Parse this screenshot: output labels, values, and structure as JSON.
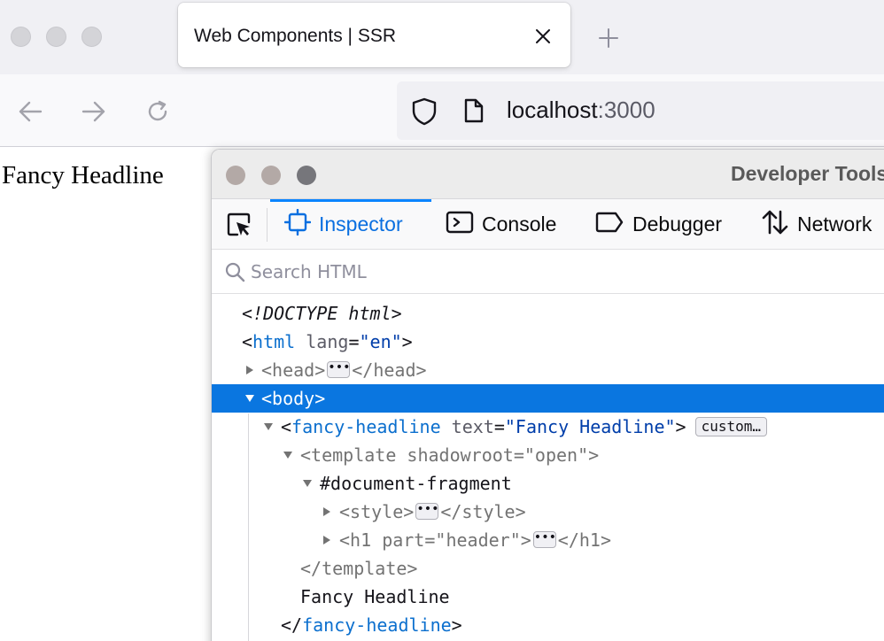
{
  "browser": {
    "tab": {
      "title": "Web Components | SSR"
    },
    "url": {
      "host": "localhost",
      "port": ":3000"
    }
  },
  "page": {
    "headline": "Fancy Headline"
  },
  "devtools": {
    "title": "Developer Tools",
    "tabs": [
      {
        "label": "Inspector",
        "icon": "inspector-icon",
        "selected": true
      },
      {
        "label": "Console",
        "icon": "console-icon"
      },
      {
        "label": "Debugger",
        "icon": "debugger-icon"
      },
      {
        "label": "Network",
        "icon": "network-icon"
      }
    ],
    "search_placeholder": "Search HTML",
    "tree": {
      "doctype": "<!DOCTYPE html>",
      "html": {
        "tag": "html",
        "attr": "lang",
        "value": "\"en\""
      },
      "head": {
        "tag": "head",
        "close": "</head>"
      },
      "body": {
        "tag": "body"
      },
      "fancy": {
        "tag": "fancy-headline",
        "attr": "text",
        "value": "\"Fancy Headline\"",
        "badge": "custom…"
      },
      "template": {
        "tag": "template",
        "attr": "shadowroot",
        "value": "\"open\"",
        "close": "</template>"
      },
      "fragment": "#document-fragment",
      "style": {
        "tag": "style",
        "close": "</style>"
      },
      "h1": {
        "tag": "h1",
        "attr": "part",
        "value": "\"header\"",
        "close": "</h1>"
      },
      "text_node": "Fancy Headline",
      "fancy_close": "fancy-headline",
      "ellipsis": "•••"
    }
  }
}
